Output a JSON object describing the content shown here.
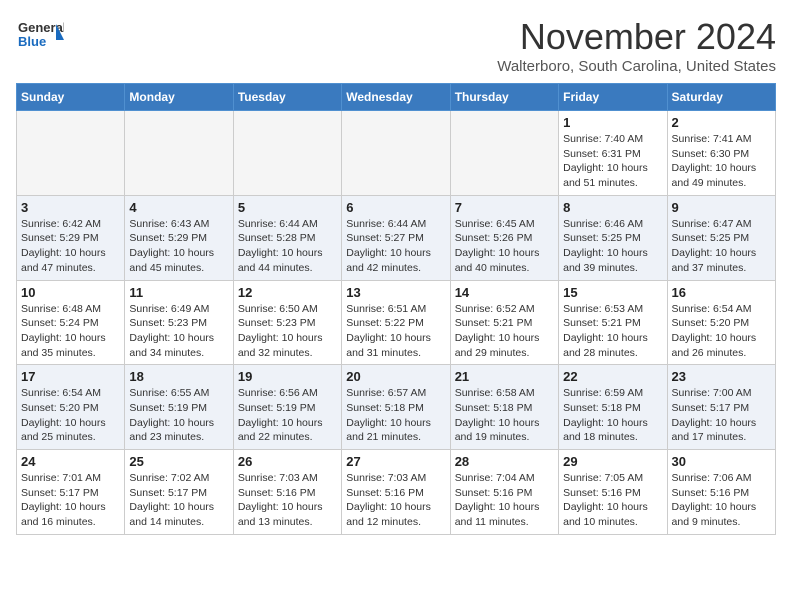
{
  "header": {
    "logo_line1": "General",
    "logo_line2": "Blue",
    "month": "November 2024",
    "location": "Walterboro, South Carolina, United States"
  },
  "days_of_week": [
    "Sunday",
    "Monday",
    "Tuesday",
    "Wednesday",
    "Thursday",
    "Friday",
    "Saturday"
  ],
  "weeks": [
    [
      {
        "day": "",
        "info": ""
      },
      {
        "day": "",
        "info": ""
      },
      {
        "day": "",
        "info": ""
      },
      {
        "day": "",
        "info": ""
      },
      {
        "day": "",
        "info": ""
      },
      {
        "day": "1",
        "info": "Sunrise: 7:40 AM\nSunset: 6:31 PM\nDaylight: 10 hours and 51 minutes."
      },
      {
        "day": "2",
        "info": "Sunrise: 7:41 AM\nSunset: 6:30 PM\nDaylight: 10 hours and 49 minutes."
      }
    ],
    [
      {
        "day": "3",
        "info": "Sunrise: 6:42 AM\nSunset: 5:29 PM\nDaylight: 10 hours and 47 minutes."
      },
      {
        "day": "4",
        "info": "Sunrise: 6:43 AM\nSunset: 5:29 PM\nDaylight: 10 hours and 45 minutes."
      },
      {
        "day": "5",
        "info": "Sunrise: 6:44 AM\nSunset: 5:28 PM\nDaylight: 10 hours and 44 minutes."
      },
      {
        "day": "6",
        "info": "Sunrise: 6:44 AM\nSunset: 5:27 PM\nDaylight: 10 hours and 42 minutes."
      },
      {
        "day": "7",
        "info": "Sunrise: 6:45 AM\nSunset: 5:26 PM\nDaylight: 10 hours and 40 minutes."
      },
      {
        "day": "8",
        "info": "Sunrise: 6:46 AM\nSunset: 5:25 PM\nDaylight: 10 hours and 39 minutes."
      },
      {
        "day": "9",
        "info": "Sunrise: 6:47 AM\nSunset: 5:25 PM\nDaylight: 10 hours and 37 minutes."
      }
    ],
    [
      {
        "day": "10",
        "info": "Sunrise: 6:48 AM\nSunset: 5:24 PM\nDaylight: 10 hours and 35 minutes."
      },
      {
        "day": "11",
        "info": "Sunrise: 6:49 AM\nSunset: 5:23 PM\nDaylight: 10 hours and 34 minutes."
      },
      {
        "day": "12",
        "info": "Sunrise: 6:50 AM\nSunset: 5:23 PM\nDaylight: 10 hours and 32 minutes."
      },
      {
        "day": "13",
        "info": "Sunrise: 6:51 AM\nSunset: 5:22 PM\nDaylight: 10 hours and 31 minutes."
      },
      {
        "day": "14",
        "info": "Sunrise: 6:52 AM\nSunset: 5:21 PM\nDaylight: 10 hours and 29 minutes."
      },
      {
        "day": "15",
        "info": "Sunrise: 6:53 AM\nSunset: 5:21 PM\nDaylight: 10 hours and 28 minutes."
      },
      {
        "day": "16",
        "info": "Sunrise: 6:54 AM\nSunset: 5:20 PM\nDaylight: 10 hours and 26 minutes."
      }
    ],
    [
      {
        "day": "17",
        "info": "Sunrise: 6:54 AM\nSunset: 5:20 PM\nDaylight: 10 hours and 25 minutes."
      },
      {
        "day": "18",
        "info": "Sunrise: 6:55 AM\nSunset: 5:19 PM\nDaylight: 10 hours and 23 minutes."
      },
      {
        "day": "19",
        "info": "Sunrise: 6:56 AM\nSunset: 5:19 PM\nDaylight: 10 hours and 22 minutes."
      },
      {
        "day": "20",
        "info": "Sunrise: 6:57 AM\nSunset: 5:18 PM\nDaylight: 10 hours and 21 minutes."
      },
      {
        "day": "21",
        "info": "Sunrise: 6:58 AM\nSunset: 5:18 PM\nDaylight: 10 hours and 19 minutes."
      },
      {
        "day": "22",
        "info": "Sunrise: 6:59 AM\nSunset: 5:18 PM\nDaylight: 10 hours and 18 minutes."
      },
      {
        "day": "23",
        "info": "Sunrise: 7:00 AM\nSunset: 5:17 PM\nDaylight: 10 hours and 17 minutes."
      }
    ],
    [
      {
        "day": "24",
        "info": "Sunrise: 7:01 AM\nSunset: 5:17 PM\nDaylight: 10 hours and 16 minutes."
      },
      {
        "day": "25",
        "info": "Sunrise: 7:02 AM\nSunset: 5:17 PM\nDaylight: 10 hours and 14 minutes."
      },
      {
        "day": "26",
        "info": "Sunrise: 7:03 AM\nSunset: 5:16 PM\nDaylight: 10 hours and 13 minutes."
      },
      {
        "day": "27",
        "info": "Sunrise: 7:03 AM\nSunset: 5:16 PM\nDaylight: 10 hours and 12 minutes."
      },
      {
        "day": "28",
        "info": "Sunrise: 7:04 AM\nSunset: 5:16 PM\nDaylight: 10 hours and 11 minutes."
      },
      {
        "day": "29",
        "info": "Sunrise: 7:05 AM\nSunset: 5:16 PM\nDaylight: 10 hours and 10 minutes."
      },
      {
        "day": "30",
        "info": "Sunrise: 7:06 AM\nSunset: 5:16 PM\nDaylight: 10 hours and 9 minutes."
      }
    ]
  ]
}
